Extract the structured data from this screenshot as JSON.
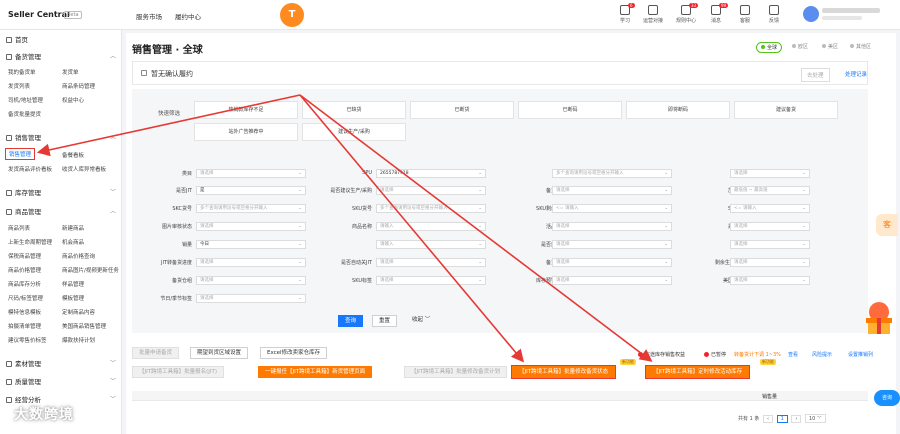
{
  "topbar": {
    "brand": "Seller Central",
    "beta": "Beta",
    "nav": [
      "服务市场",
      "履约中心"
    ],
    "logo_letter": "T",
    "icons": [
      {
        "label": "学习",
        "badge": "6"
      },
      {
        "label": "运营对接",
        "badge": ""
      },
      {
        "label": "规则中心",
        "badge": "33"
      },
      {
        "label": "消息",
        "badge": "99"
      },
      {
        "label": "客服",
        "badge": ""
      },
      {
        "label": "反馈",
        "badge": ""
      }
    ]
  },
  "sidebar": {
    "home": "首页",
    "sections": [
      {
        "title": "备货管理",
        "items": [
          [
            "我的备货单",
            "发货单"
          ],
          [
            "发货列表",
            "商品条码管理"
          ],
          [
            "司机/地址管理",
            "权益中心"
          ],
          [
            "备货批量提货",
            ""
          ]
        ]
      },
      {
        "title": "销售管理",
        "items": [
          [
            "销售管理",
            "备餐看板"
          ],
          [
            "发货商品评价看板",
            "收货人库异常看板"
          ]
        ]
      },
      {
        "title": "库存管理",
        "items": []
      },
      {
        "title": "商品管理",
        "items": [
          [
            "商品列表",
            "新建商品"
          ],
          [
            "上新生命周期管理",
            "机会商品"
          ],
          [
            "保税商品管理",
            "商品价格查询"
          ],
          [
            "商品价格管理",
            "商品图片/视频更新任务"
          ],
          [
            "商品库存分析",
            "样品管理"
          ],
          [
            "尺码/标签管理",
            "模板管理"
          ],
          [
            "模特信息模板",
            "定制商品内容"
          ],
          [
            "拍摄清单管理",
            "美国商品销售管理"
          ],
          [
            "建议零售价标签",
            "爆款扶持计划"
          ]
        ]
      },
      {
        "title": "素材管理",
        "items": []
      },
      {
        "title": "质量管理",
        "items": []
      },
      {
        "title": "经营分析",
        "items": []
      }
    ]
  },
  "main": {
    "title": "销售管理 · 全球",
    "regions": [
      "全球",
      "欧区",
      "美区",
      "其他区"
    ],
    "notice": "暂无确认履约",
    "notice_btn1": "去处理",
    "notice_btn2": "处理记录",
    "quick_filter_label": "快速筛选",
    "quick_filters": [
      "热销款库存不足",
      "已缺货",
      "已断货",
      "已断码",
      "即将断码",
      "建议备货",
      "站外广告推荐中",
      "建议生产/采购"
    ],
    "filters": [
      [
        {
          "label": "类目",
          "value": "请选择",
          "v": false
        },
        {
          "label": "SPU",
          "value": "2655787918",
          "v": true
        },
        {
          "label": "SKC",
          "value": "多个查询请用逗号或空格分开输入",
          "v": false
        },
        {
          "label": "是否VMI",
          "value": "请选择",
          "v": false
        }
      ],
      [
        {
          "label": "是否JIT",
          "value": "是",
          "v": true
        },
        {
          "label": "是否建议生产/采购",
          "value": "请选择",
          "v": false
        },
        {
          "label": "备货区域",
          "value": "请选择",
          "v": false
        },
        {
          "label": "加入站点时长",
          "value": "最低值 ~ 最高值",
          "v": false
        }
      ],
      [
        {
          "label": "SKC货号",
          "value": "多个查询请用逗号或空格分开输入",
          "v": false
        },
        {
          "label": "SKU货号",
          "value": "多个查询请用逗号或空格分开输入",
          "v": false
        },
        {
          "label": "SKU剩余库存",
          "value": "<=  请输入",
          "v": false
        },
        {
          "label": "SKU可售天数",
          "value": "<=  请输入",
          "v": false
        }
      ],
      [
        {
          "label": "图片审核状态",
          "value": "请选择",
          "v": false
        },
        {
          "label": "商品名称",
          "value": "请输入",
          "v": false
        },
        {
          "label": "活品状态",
          "value": "请选择",
          "v": false
        },
        {
          "label": "是否定制商品",
          "value": "请选择",
          "v": false
        }
      ],
      [
        {
          "label": "销量",
          "value": "今日",
          "v": true
        },
        {
          "label": "",
          "value": "请输入",
          "v": false
        },
        {
          "label": "是否热销款",
          "value": "请选择",
          "v": false
        },
        {
          "label": "商品评分",
          "value": "请选择",
          "v": false
        }
      ],
      [
        {
          "label": "JIT转备货进度",
          "value": "请选择",
          "v": false
        },
        {
          "label": "是否自动关JIT",
          "value": "请选择",
          "v": false
        },
        {
          "label": "备货状态",
          "value": "请选择",
          "v": false
        },
        {
          "label": "剩余生产待数天于0",
          "value": "请选择",
          "v": false
        }
      ],
      [
        {
          "label": "备货仓组",
          "value": "请选择",
          "v": false
        },
        {
          "label": "SKU标签",
          "value": "请选择",
          "v": false
        },
        {
          "label": "库存预警类型",
          "value": "请选择",
          "v": false
        },
        {
          "label": "美国销售潜力品",
          "value": "请选择",
          "v": false
        }
      ],
      [
        {
          "label": "节日/季节标签",
          "value": "请选择",
          "v": false
        }
      ]
    ],
    "btn_search": "查询",
    "btn_reset": "重置",
    "btn_collapse": "收起",
    "actions_row1": [
      "批量申请备货",
      "期望到货区域设置",
      "Excel修改卖家仓库存"
    ],
    "alerts": [
      "在途库存销售权益",
      "已暂停",
      "转备货计下调 1~3%",
      "查看"
    ],
    "alert_links": [
      "风险提示",
      "设置推销列"
    ],
    "actions_row2": [
      "【JIT跨境工具箱】批量报名(JIT)",
      "一键报任【JIT跨境工具箱】新货管理页面",
      "【JIT跨境工具箱】批量修改备货计划",
      "【JIT跨境工具箱】批量修改备货状态",
      "【JIT跨境工具箱】定时修改活动库存"
    ],
    "new_tag": "新功能",
    "table_col": "销售量",
    "pager": {
      "total": "共有 1 条",
      "page": "1",
      "size": "10"
    }
  },
  "float": {
    "right_tab": "客",
    "chat": "咨询"
  },
  "watermark": "大数跨境"
}
